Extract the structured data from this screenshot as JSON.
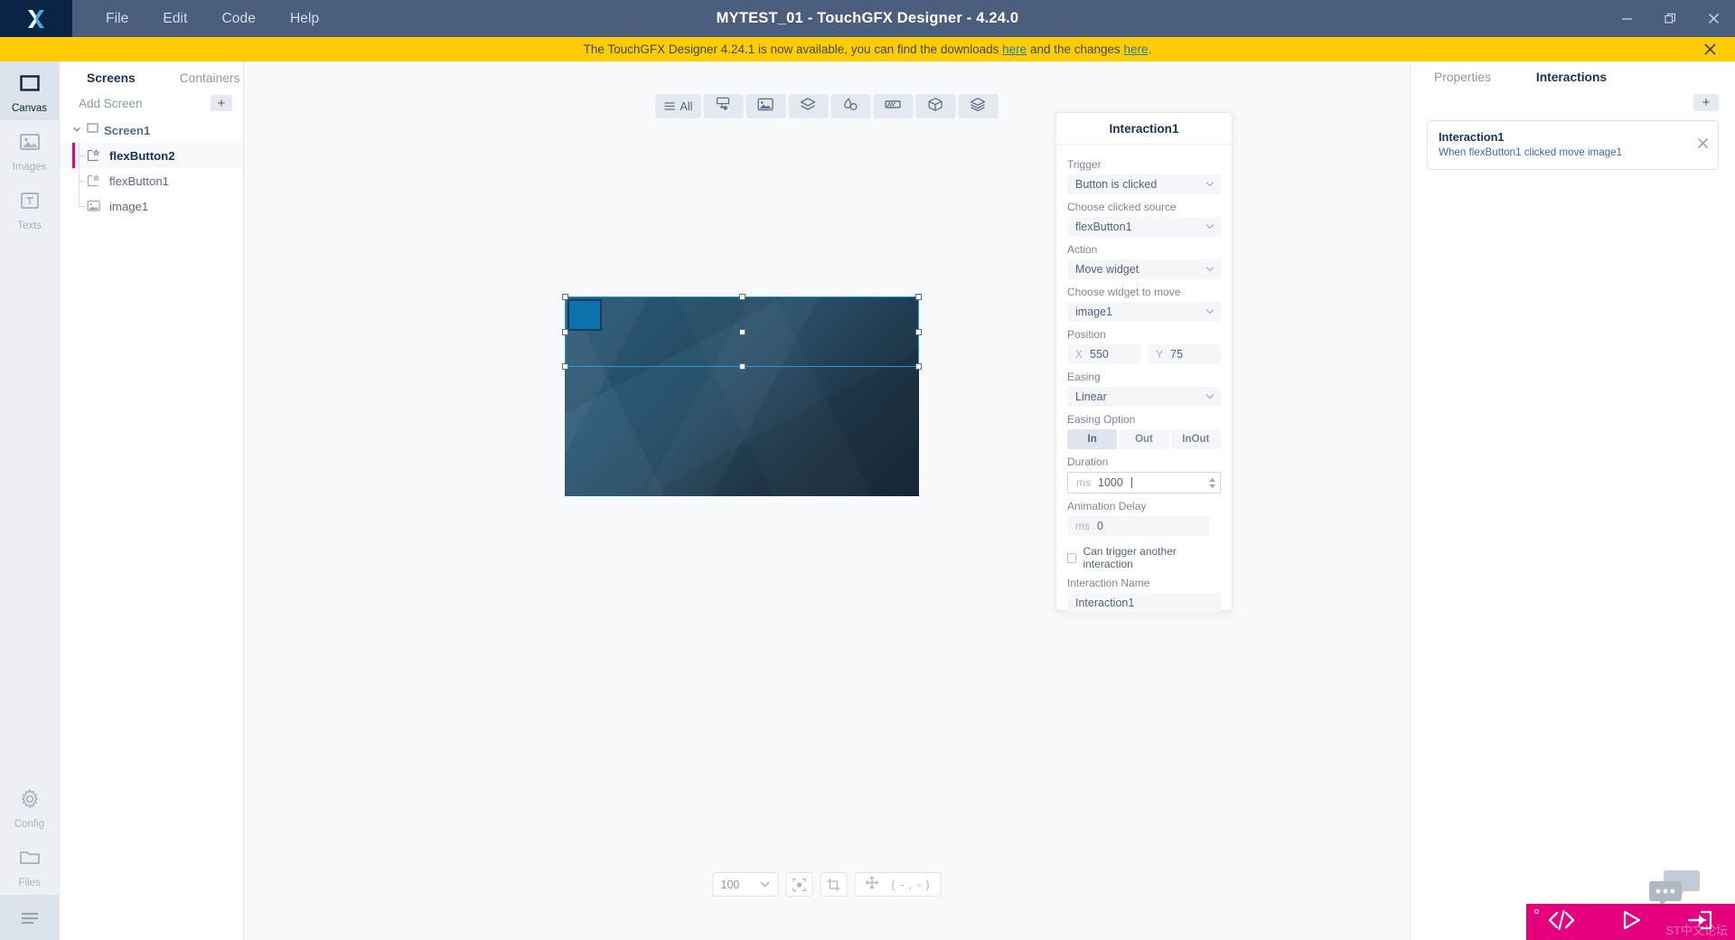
{
  "titlebar": {
    "logo_icon": "touchgfx-x-logo",
    "menus": [
      "File",
      "Edit",
      "Code",
      "Help"
    ],
    "window_title": "MYTEST_01 - TouchGFX Designer - 4.24.0",
    "minimize_icon": "minimize-icon",
    "restore_icon": "restore-icon",
    "close_icon": "close-icon"
  },
  "banner": {
    "text_before": "The TouchGFX Designer 4.24.1 is now available, you can find the downloads ",
    "link1": "here",
    "text_middle": " and the changes ",
    "link2": "here",
    "text_after": ".",
    "close_icon": "banner-close-icon",
    "bg_color": "#ffcc00"
  },
  "rail": {
    "items": [
      {
        "label": "Canvas",
        "icon": "canvas-rect-icon",
        "active": true
      },
      {
        "label": "Images",
        "icon": "images-picture-icon",
        "active": false
      },
      {
        "label": "Texts",
        "icon": "texts-t-icon",
        "active": false
      }
    ],
    "bottom_items": [
      {
        "label": "Config",
        "icon": "gear-icon",
        "active": false
      },
      {
        "label": "Files",
        "icon": "folder-icon",
        "active": false
      }
    ],
    "menu_icon": "hamburger-menu-icon"
  },
  "tree": {
    "tabs": [
      {
        "label": "Screens",
        "active": true
      },
      {
        "label": "Containers",
        "active": false
      }
    ],
    "add_screen_label": "Add Screen",
    "add_button_label": "+",
    "root": {
      "label": "Screen1",
      "caret_icon": "chevron-down-icon",
      "checkbox_icon": "screen-square-icon"
    },
    "children": [
      {
        "label": "flexButton2",
        "icon": "flexbutton-icon",
        "selected": true
      },
      {
        "label": "flexButton1",
        "icon": "flexbutton-icon",
        "selected": false
      },
      {
        "label": "image1",
        "icon": "image-icon",
        "selected": false
      }
    ]
  },
  "widget_toolbar": {
    "buttons": [
      {
        "label": "All",
        "icon": "list-all-icon"
      },
      {
        "label": "",
        "icon": "button-widget-icon"
      },
      {
        "label": "",
        "icon": "image-widget-icon"
      },
      {
        "label": "",
        "icon": "container-layers-icon"
      },
      {
        "label": "",
        "icon": "shape-icon"
      },
      {
        "label": "",
        "icon": "progress-widget-icon"
      },
      {
        "label": "",
        "icon": "cube-3d-icon"
      },
      {
        "label": "",
        "icon": "miscellaneous-layers-icon"
      }
    ]
  },
  "canvas": {
    "selection": {
      "handle_count": 8,
      "border_color": "#14a0e6"
    },
    "flexbutton_color": "#0b72ab"
  },
  "bottom_toolbar": {
    "zoom_value": "100",
    "zoom_caret_icon": "chevron-down-icon",
    "fit_icon": "fit-to-screen-icon",
    "crop_icon": "crop-icon",
    "move_icon": "move-arrows-icon",
    "coordinates": "( - , - )"
  },
  "interaction_editor": {
    "title": "Interaction1",
    "trigger_label": "Trigger",
    "trigger_value": "Button is clicked",
    "source_label": "Choose clicked source",
    "source_value": "flexButton1",
    "action_label": "Action",
    "action_value": "Move widget",
    "widget_label": "Choose widget to move",
    "widget_value": "image1",
    "position_label": "Position",
    "position_x_prefix": "X",
    "position_x": "550",
    "position_y_prefix": "Y",
    "position_y": "75",
    "easing_label": "Easing",
    "easing_value": "Linear",
    "easing_option_label": "Easing Option",
    "easing_options": [
      {
        "label": "In",
        "active": true
      },
      {
        "label": "Out",
        "active": false
      },
      {
        "label": "InOut",
        "active": false
      }
    ],
    "duration_label": "Duration",
    "duration_unit": "ms",
    "duration_value": "1000",
    "delay_label": "Animation Delay",
    "delay_unit": "ms",
    "delay_value": "0",
    "can_trigger_label": "Can trigger another interaction",
    "can_trigger_checked": false,
    "name_label": "Interaction Name",
    "name_value": "Interaction1"
  },
  "right_panel": {
    "tabs": [
      {
        "label": "Properties",
        "active": false
      },
      {
        "label": "Interactions",
        "active": true
      }
    ],
    "add_button_label": "+",
    "interactions": [
      {
        "title": "Interaction1",
        "description": "When flexButton1 clicked move image1",
        "close_icon": "close-icon"
      }
    ]
  },
  "action_bar": {
    "code_icon": "code-brackets-icon",
    "run_icon": "play-run-icon",
    "export_icon": "export-arrow-icon",
    "bg_color": "#e6007e",
    "watermark": "ST中文论坛",
    "chat_icon": "chat-bubbles-icon"
  }
}
